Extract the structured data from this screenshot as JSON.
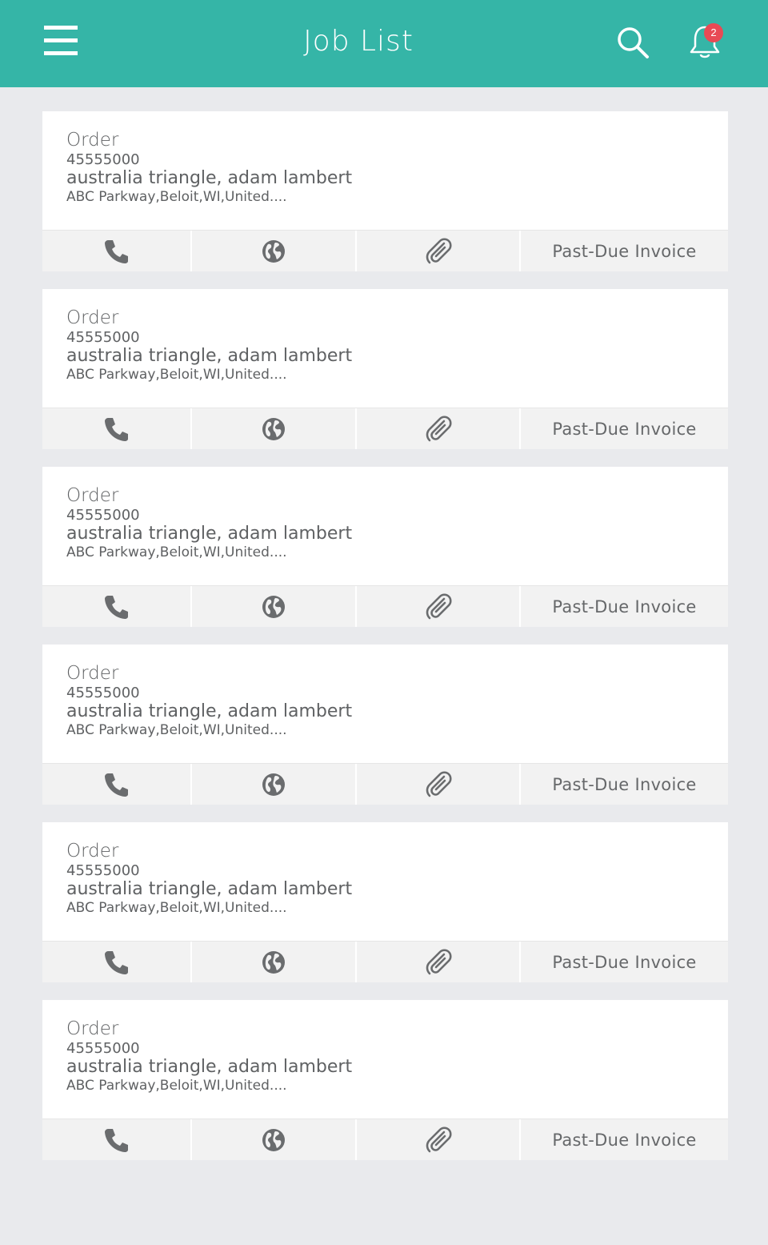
{
  "header": {
    "title": "Job List",
    "notification_count": "2",
    "color": "#35b5a7",
    "icons": [
      "menu-icon",
      "search-icon",
      "bell-icon"
    ]
  },
  "jobs": [
    {
      "label": "Order",
      "number": "45555000",
      "name": "australia triangle, adam lambert",
      "address": "ABC Parkway,Beloit,WI,United....",
      "invoice_label": "Past-Due Invoice"
    },
    {
      "label": "Order",
      "number": "45555000",
      "name": "australia triangle, adam lambert",
      "address": "ABC Parkway,Beloit,WI,United....",
      "invoice_label": "Past-Due Invoice"
    },
    {
      "label": "Order",
      "number": "45555000",
      "name": "australia triangle, adam lambert",
      "address": "ABC Parkway,Beloit,WI,United....",
      "invoice_label": "Past-Due Invoice"
    },
    {
      "label": "Order",
      "number": "45555000",
      "name": "australia triangle, adam lambert",
      "address": "ABC Parkway,Beloit,WI,United....",
      "invoice_label": "Past-Due Invoice"
    },
    {
      "label": "Order",
      "number": "45555000",
      "name": "australia triangle, adam lambert",
      "address": "ABC Parkway,Beloit,WI,United....",
      "invoice_label": "Past-Due Invoice"
    },
    {
      "label": "Order",
      "number": "45555000",
      "name": "australia triangle, adam lambert",
      "address": "ABC Parkway,Beloit,WI,United....",
      "invoice_label": "Past-Due Invoice"
    }
  ],
  "action_icons": [
    "phone-icon",
    "globe-icon",
    "paperclip-icon"
  ]
}
